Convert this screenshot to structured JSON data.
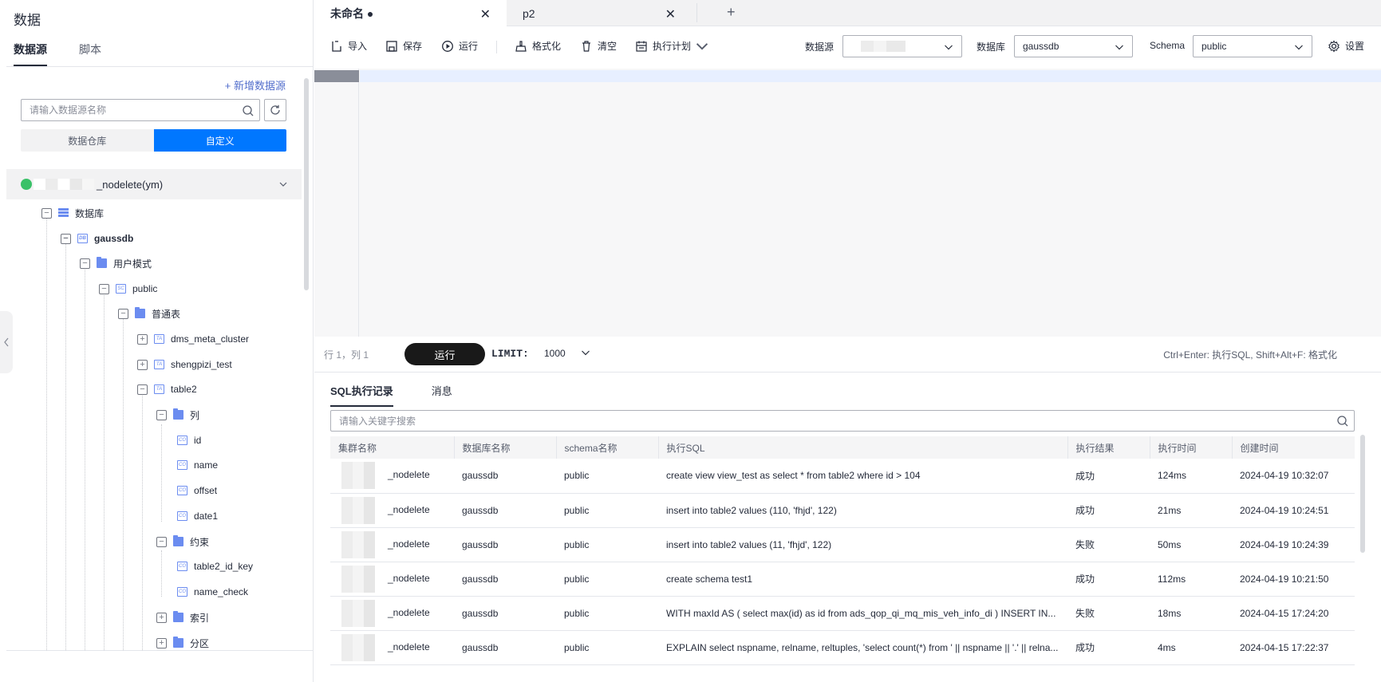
{
  "left": {
    "title": "数据",
    "tabs": [
      "数据源",
      "脚本"
    ],
    "add_datasource": "+ 新增数据源",
    "search_placeholder": "请输入数据源名称",
    "segments": [
      "数据仓库",
      "自定义"
    ],
    "root_label": "_nodelete(ym)",
    "tree": {
      "database": "数据库",
      "gaussdb": "gaussdb",
      "user_schema": "用户模式",
      "public": "public",
      "normal_table": "普通表",
      "t1": "dms_meta_cluster",
      "t2": "shengpizi_test",
      "t3": "table2",
      "columns": "列",
      "c1": "id",
      "c2": "name",
      "c3": "offset",
      "c4": "date1",
      "constraints": "约束",
      "k1": "table2_id_key",
      "k2": "name_check",
      "index": "索引",
      "partition": "分区"
    }
  },
  "tabs": [
    {
      "label": "未命名 ●"
    },
    {
      "label": "p2"
    }
  ],
  "toolbar": {
    "import": "导入",
    "save": "保存",
    "run": "运行",
    "format": "格式化",
    "clear": "清空",
    "plan": "执行计划",
    "ds_label": "数据源",
    "db_label": "数据库",
    "db_value": "gaussdb",
    "schema_label": "Schema",
    "schema_value": "public",
    "settings": "设置"
  },
  "runbar": {
    "position": "行 1，列 1",
    "run": "运行",
    "limit_label": "LIMIT:",
    "limit_value": "1000",
    "hint": "Ctrl+Enter: 执行SQL, Shift+Alt+F: 格式化"
  },
  "results": {
    "tabs": [
      "SQL执行记录",
      "消息"
    ],
    "search_placeholder": "请输入关键字搜索",
    "columns": [
      "集群名称",
      "数据库名称",
      "schema名称",
      "执行SQL",
      "执行结果",
      "执行时间",
      "创建时间"
    ],
    "rows": [
      [
        "_nodelete",
        "gaussdb",
        "public",
        "create view view_test as select * from table2 where id > 104",
        "成功",
        "124ms",
        "2024-04-19 10:32:07"
      ],
      [
        "_nodelete",
        "gaussdb",
        "public",
        "insert into table2 values (110, 'fhjd', 122)",
        "成功",
        "21ms",
        "2024-04-19 10:24:51"
      ],
      [
        "_nodelete",
        "gaussdb",
        "public",
        "insert into table2 values (11, 'fhjd', 122)",
        "失败",
        "50ms",
        "2024-04-19 10:24:39"
      ],
      [
        "_nodelete",
        "gaussdb",
        "public",
        "create schema test1",
        "成功",
        "112ms",
        "2024-04-19 10:21:50"
      ],
      [
        "_nodelete",
        "gaussdb",
        "public",
        "WITH maxId AS ( select max(id) as id from ads_qop_qi_mq_mis_veh_info_di ) INSERT IN...",
        "失败",
        "18ms",
        "2024-04-15 17:24:20"
      ],
      [
        "_nodelete",
        "gaussdb",
        "public",
        "EXPLAIN select nspname, relname, reltuples, 'select count(*) from ' || nspname || '.' || relna...",
        "成功",
        "4ms",
        "2024-04-15 17:22:37"
      ]
    ]
  }
}
